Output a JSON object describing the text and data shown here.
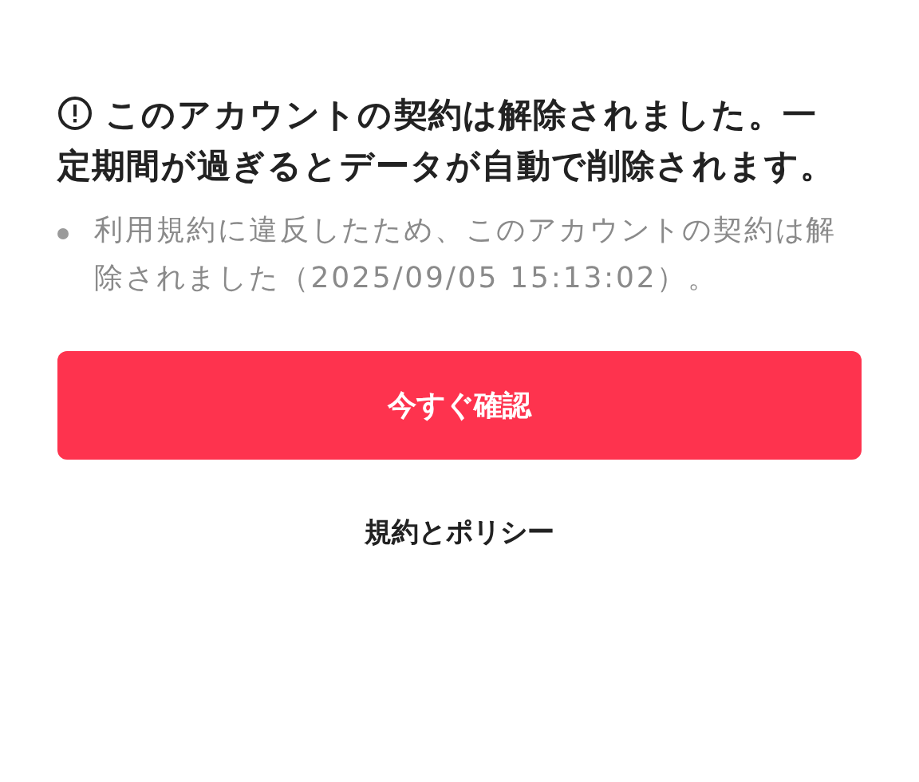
{
  "notice": {
    "title": "このアカウントの契約は解除されました。一定期間が過ぎるとデータが自動で削除されます。",
    "details": [
      "利用規約に違反したため、このアカウントの契約は解除されました（2025/09/05 15:13:02）。"
    ]
  },
  "buttons": [
    {
      "kind": "primary",
      "label": "今すぐ確認"
    },
    {
      "kind": "link",
      "label": "規約とポリシー"
    }
  ]
}
